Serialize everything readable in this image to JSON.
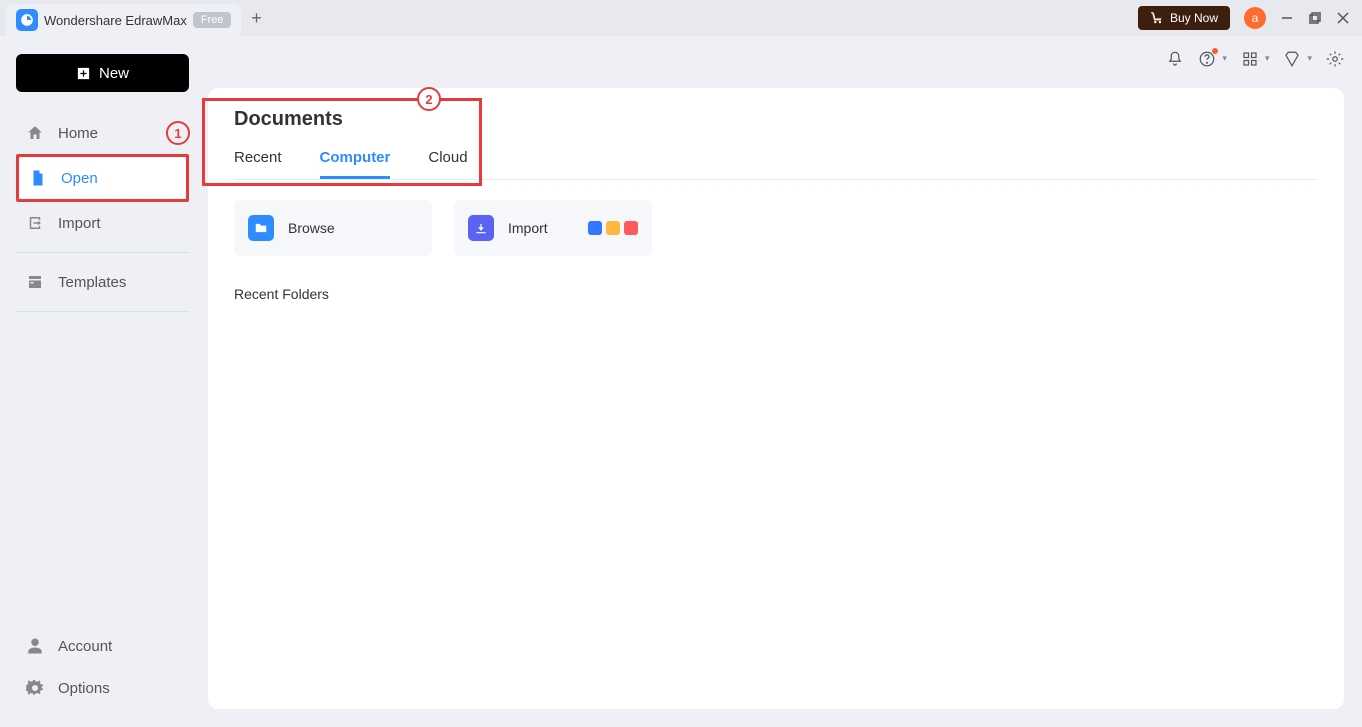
{
  "colors": {
    "accent": "#2f8cff",
    "annotation": "#e73a3a",
    "avatar_bg": "#ff6a2f",
    "buy_bg": "#3d1f0f"
  },
  "titlebar": {
    "app_name": "Wondershare EdrawMax",
    "badge": "Free",
    "buy_label": "Buy Now",
    "avatar_letter": "a"
  },
  "sidebar": {
    "new_label": "New",
    "nav": [
      {
        "key": "home",
        "label": "Home"
      },
      {
        "key": "open",
        "label": "Open",
        "active": true
      },
      {
        "key": "import",
        "label": "Import"
      }
    ],
    "templates_label": "Templates",
    "bottom": [
      {
        "key": "account",
        "label": "Account"
      },
      {
        "key": "options",
        "label": "Options"
      }
    ]
  },
  "annotations": {
    "a1": "1",
    "a2": "2"
  },
  "main": {
    "heading": "Documents",
    "tabs": [
      {
        "key": "recent",
        "label": "Recent"
      },
      {
        "key": "computer",
        "label": "Computer",
        "active": true
      },
      {
        "key": "cloud",
        "label": "Cloud"
      }
    ],
    "cards": {
      "browse": "Browse",
      "import": "Import"
    },
    "recent_folders_heading": "Recent Folders"
  }
}
